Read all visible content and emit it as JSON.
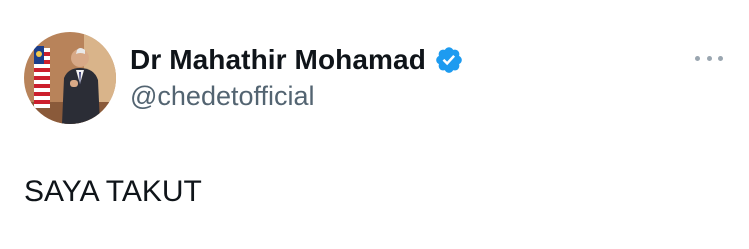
{
  "author": {
    "display_name": "Dr Mahathir Mohamad",
    "handle": "@chedetofficial",
    "verified": true
  },
  "tweet": {
    "text": "SAYA TAKUT"
  },
  "icons": {
    "verified": "verified-badge-icon",
    "more": "more-options-icon"
  },
  "colors": {
    "verified_blue": "#1d9bf0",
    "handle_gray": "#536471",
    "text": "#0f1419"
  }
}
